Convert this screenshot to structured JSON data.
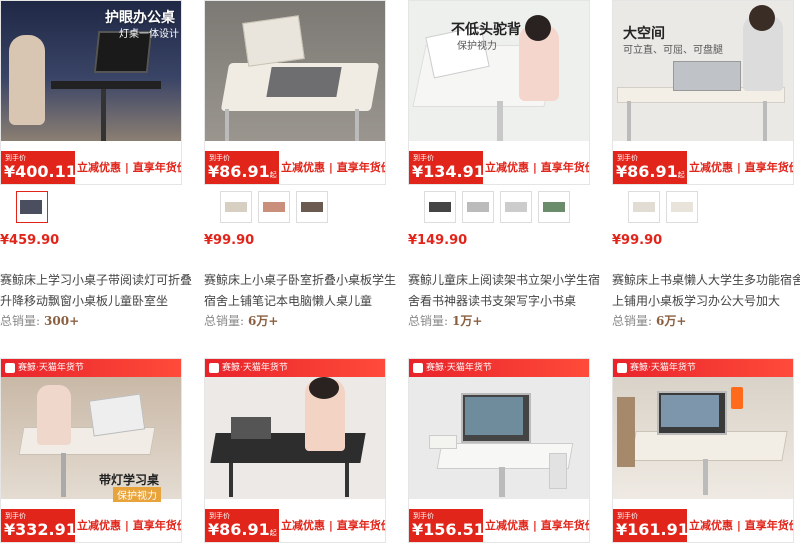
{
  "badge_text": "赛鲸·天猫年货节",
  "tag_label": "到手价",
  "promo": {
    "left": "立减优惠",
    "right": "直享年货价"
  },
  "sales_label": "总销量:",
  "products": [
    {
      "price_tag": "400.11",
      "price": "¥459.90",
      "title": "赛鲸床上学习小桌子带阅读灯可折叠升降移动飘窗小桌板儿童卧室坐",
      "sales": "300+",
      "overlay_title": "护眼办公桌",
      "overlay_sub": "灯桌一体设计",
      "photo_color": "#2b3350",
      "thumbs": 1
    },
    {
      "price_tag": "86.91",
      "price": "¥99.90",
      "title": "赛鲸床上小桌子卧室折叠小桌板学生宿舍上铺笔记本电脑懒人桌儿童",
      "sales": "6万+",
      "overlay_title": "",
      "overlay_sub": "",
      "photo_color": "#8d8a86",
      "thumbs": 3
    },
    {
      "price_tag": "134.91",
      "price": "¥149.90",
      "title": "赛鲸儿童床上阅读架书立架小学生宿舍看书神器读书支架写字小书桌",
      "sales": "1万+",
      "overlay_title": "不低头驼背",
      "overlay_sub": "保护视力",
      "photo_color": "#eef0ee",
      "thumbs": 4
    },
    {
      "price_tag": "86.91",
      "price": "¥99.90",
      "title": "赛鲸床上书桌懒人大学生多功能宿舍上铺用小桌板学习办公大号加大",
      "sales": "6万+",
      "overlay_title": "大空间",
      "overlay_sub": "可立直、可屈、可盘腿",
      "photo_color": "#e9e7e4",
      "thumbs": 2
    },
    {
      "price_tag": "332.91",
      "price": "",
      "title": "",
      "sales": "",
      "overlay_title": "带灯学习桌",
      "overlay_sub": "保护视力",
      "photo_color": "#d9d2c8",
      "thumbs": 0
    },
    {
      "price_tag": "86.91",
      "price": "",
      "title": "",
      "sales": "",
      "overlay_title": "",
      "overlay_sub": "",
      "photo_color": "#ece9e6",
      "thumbs": 0
    },
    {
      "price_tag": "156.51",
      "price": "",
      "title": "",
      "sales": "",
      "overlay_title": "",
      "overlay_sub": "",
      "photo_color": "#eaeaea",
      "thumbs": 0
    },
    {
      "price_tag": "161.91",
      "price": "",
      "title": "",
      "sales": "",
      "overlay_title": "",
      "overlay_sub": "",
      "photo_color": "#e2ddd6",
      "thumbs": 0
    }
  ]
}
